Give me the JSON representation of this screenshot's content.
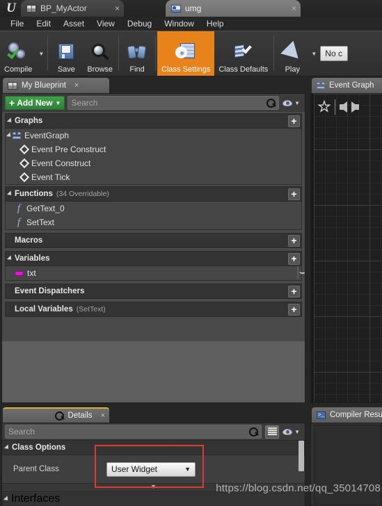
{
  "window": {
    "logo": "unreal-engine-logo",
    "tabs": [
      {
        "label": "BP_MyActor",
        "icon": "blueprint-icon",
        "close": "×",
        "active": false
      },
      {
        "label": "umg",
        "icon": "widget-blueprint-icon",
        "close": "×",
        "active": true
      }
    ]
  },
  "menubar": {
    "items": [
      "File",
      "Edit",
      "Asset",
      "View",
      "Debug",
      "Window",
      "Help"
    ]
  },
  "toolbar": {
    "buttons": [
      {
        "label": "Compile",
        "icon": "compile-gears-check-icon",
        "active": false,
        "caret": true
      },
      {
        "label": "Save",
        "icon": "floppy-disk-icon",
        "active": false,
        "caret": false
      },
      {
        "label": "Browse",
        "icon": "magnifier-icon",
        "active": false,
        "caret": false
      },
      {
        "label": "Find",
        "icon": "binoculars-icon",
        "active": false,
        "caret": false
      },
      {
        "label": "Class Settings",
        "icon": "class-settings-gear-icon",
        "active": true,
        "caret": false
      },
      {
        "label": "Class Defaults",
        "icon": "class-defaults-checklist-icon",
        "active": false,
        "caret": false
      },
      {
        "label": "Play",
        "icon": "play-triangle-icon",
        "active": false,
        "caret": true
      }
    ],
    "play_mode_value": "No c",
    "accent_color": "#e8821a"
  },
  "my_blueprint": {
    "tab": {
      "label": "My Blueprint",
      "icon": "blueprint-book-icon",
      "close": "×"
    },
    "add_new_label": "Add New",
    "add_new_plus": "+",
    "search_placeholder": "Search",
    "sections": [
      {
        "title": "Graphs",
        "subtitle": "",
        "expanded": true,
        "add": "+",
        "items": [
          {
            "label": "EventGraph",
            "icon": "event-graph-icon",
            "indent": 0,
            "expandable": true
          },
          {
            "label": "Event Pre Construct",
            "icon": "event-node-icon",
            "indent": 1,
            "expandable": false
          },
          {
            "label": "Event Construct",
            "icon": "event-node-icon",
            "indent": 1,
            "expandable": false
          },
          {
            "label": "Event Tick",
            "icon": "event-node-icon",
            "indent": 1,
            "expandable": false
          }
        ]
      },
      {
        "title": "Functions",
        "subtitle": "(34 Overridable)",
        "expanded": true,
        "add": "+",
        "items": [
          {
            "label": "GetText_0",
            "icon": "function-icon",
            "indent": 0,
            "expandable": false
          },
          {
            "label": "SetText",
            "icon": "function-icon",
            "indent": 0,
            "expandable": false
          }
        ]
      },
      {
        "title": "Macros",
        "subtitle": "",
        "expanded": false,
        "add": "+",
        "items": []
      },
      {
        "title": "Variables",
        "subtitle": "",
        "expanded": true,
        "add": "+",
        "items": [
          {
            "label": "txt",
            "icon": "text-variable-pill-icon",
            "indent": 0,
            "expandable": false,
            "trailing_icon": "eye-closed-icon",
            "pill_color": "#e618cf"
          }
        ]
      },
      {
        "title": "Event Dispatchers",
        "subtitle": "",
        "expanded": false,
        "add": "+",
        "items": []
      },
      {
        "title": "Local Variables",
        "subtitle": "(SetText)",
        "expanded": false,
        "add": "+",
        "items": []
      }
    ]
  },
  "details": {
    "tab": {
      "label": "Details",
      "icon": "details-info-icon",
      "close": "×"
    },
    "search_placeholder": "Search",
    "grid_button": "grid-view-icon",
    "class_options_title": "Class Options",
    "parent_class_label": "Parent Class",
    "parent_class_value": "User Widget",
    "interfaces_title": "Interfaces",
    "highlight_color": "#e03b2f"
  },
  "event_graph": {
    "tab": {
      "label": "Event Graph",
      "icon": "event-graph-icon"
    },
    "tools": [
      "bookmark-star-icon",
      "nav-back-arrow-icon",
      "nav-forward-arrow-icon"
    ]
  },
  "compiler_results": {
    "tab": {
      "label": "Compiler Resu",
      "icon": "console-icon"
    }
  },
  "watermark": "https://blog.csdn.net/qq_35014708"
}
